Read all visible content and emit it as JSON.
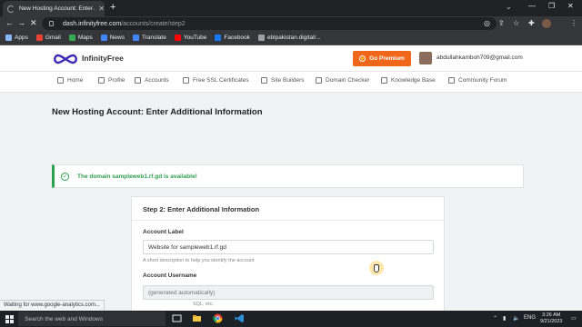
{
  "browser": {
    "tab_title": "New Hosting Account: Enter Ad",
    "url_host": "dash.infinityfree.com",
    "url_path": "/accounts/create/step2",
    "bookmarks": [
      {
        "label": "Apps",
        "icon": "apps-grid-icon",
        "color": "#8ab4f8"
      },
      {
        "label": "Gmail",
        "icon": "gmail-icon",
        "color": "#ea4335"
      },
      {
        "label": "Maps",
        "icon": "maps-icon",
        "color": "#34a853"
      },
      {
        "label": "News",
        "icon": "news-icon",
        "color": "#4285f4"
      },
      {
        "label": "Translate",
        "icon": "translate-icon",
        "color": "#4285f4"
      },
      {
        "label": "YouTube",
        "icon": "youtube-icon",
        "color": "#ff0000"
      },
      {
        "label": "Facebook",
        "icon": "facebook-icon",
        "color": "#1877f2"
      },
      {
        "label": "eblpakistan.digital/...",
        "icon": "globe-icon",
        "color": "#9aa0a6"
      }
    ],
    "status_text": "Waiting for www.google-analytics.com..."
  },
  "site": {
    "logo_text": "InfinityFree",
    "premium_label": "Go Premium",
    "user_email": "abdullahkamboh709@gmail.com",
    "nav": [
      {
        "label": "Home",
        "icon": "home-icon"
      },
      {
        "label": "Profile",
        "icon": "user-icon"
      },
      {
        "label": "Accounts",
        "icon": "accounts-icon"
      },
      {
        "label": "Free SSL Certificates",
        "icon": "shield-icon"
      },
      {
        "label": "Site Builders",
        "icon": "site-builder-icon"
      },
      {
        "label": "Domain Checker",
        "icon": "domain-check-icon"
      },
      {
        "label": "Knowledge Base",
        "icon": "question-icon"
      },
      {
        "label": "Community Forum",
        "icon": "forum-icon"
      }
    ],
    "accent_color": "#f0661a",
    "success_color": "#2e9e4f"
  },
  "page": {
    "title": "New Hosting Account: Enter Additional Information",
    "alert_message": "The domain sampleweb1.rf.gd is available!",
    "card_title": "Step 2: Enter Additional Information",
    "account_label": {
      "label": "Account Label",
      "value": "Website for sampleweb1.rf.gd",
      "help": "A short description to help you identify the account"
    },
    "account_username": {
      "label": "Account Username",
      "placeholder": "(generated automatically)"
    },
    "partial_help": "SQL, etc."
  },
  "taskbar": {
    "search_placeholder": "Search the web and Windows",
    "language": "ENG",
    "time": "3:26 AM",
    "date": "9/21/2023"
  }
}
